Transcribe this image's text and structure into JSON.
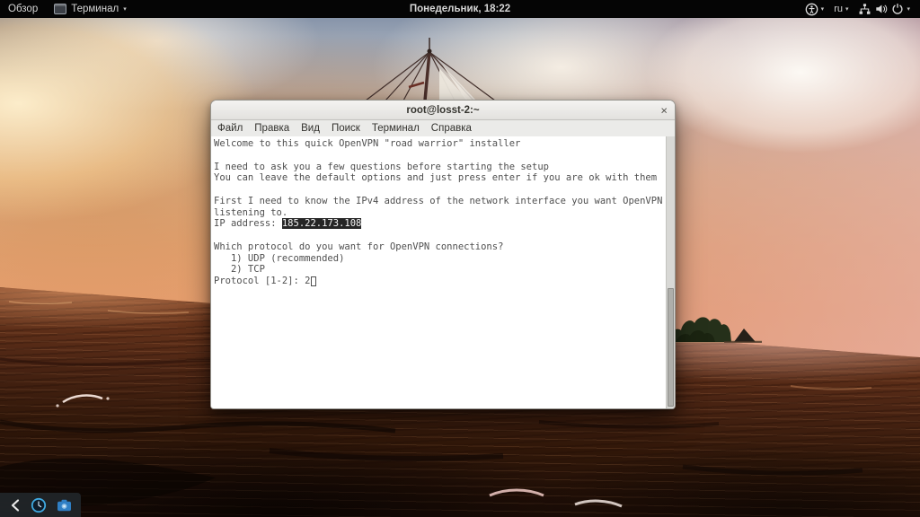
{
  "top_bar": {
    "activities_label": "Обзор",
    "app_name": "Терминал",
    "clock": "Понедельник, 18:22",
    "keyboard_layout": "ru",
    "caret_glyph": "▾",
    "icons": [
      "terminal-app-icon",
      "accessibility-icon",
      "network-wired-icon",
      "volume-icon",
      "power-icon"
    ]
  },
  "window": {
    "title": "root@losst-2:~",
    "close_glyph": "×",
    "menu_items": [
      "Файл",
      "Правка",
      "Вид",
      "Поиск",
      "Терминал",
      "Справка"
    ]
  },
  "terminal": {
    "lines": [
      [
        {
          "text": "Welcome to this quick OpenVPN \"road warrior\" installer"
        }
      ],
      [],
      [
        {
          "text": "I need to ask you a few questions before starting the setup"
        }
      ],
      [
        {
          "text": "You can leave the default options and just press enter if you are ok with them"
        }
      ],
      [],
      [
        {
          "text": "First I need to know the IPv4 address of the network interface you want OpenVPN"
        }
      ],
      [
        {
          "text": "listening to."
        }
      ],
      [
        {
          "text": "IP address: "
        },
        {
          "text": "185.22.173.108",
          "highlight": true
        }
      ],
      [],
      [
        {
          "text": "Which protocol do you want for OpenVPN connections?"
        }
      ],
      [
        {
          "text": "   1) UDP (recommended)"
        }
      ],
      [
        {
          "text": "   2) TCP"
        }
      ],
      [
        {
          "text": "Protocol [1-2]: 2"
        },
        {
          "cursor": true
        }
      ]
    ]
  },
  "quickbar": {
    "icons": [
      "chevron-left-icon",
      "clock-app-icon",
      "camera-icon"
    ]
  },
  "colors": {
    "topbar_bg": "#050505",
    "selection_bg": "#262626",
    "selection_fg": "#f5f5f5",
    "terminal_fg": "#4f4f4f",
    "titlebar_bg": "#ebeae8",
    "camera_blue": "#2f7fc4",
    "ring_blue": "#3fa9e1"
  }
}
